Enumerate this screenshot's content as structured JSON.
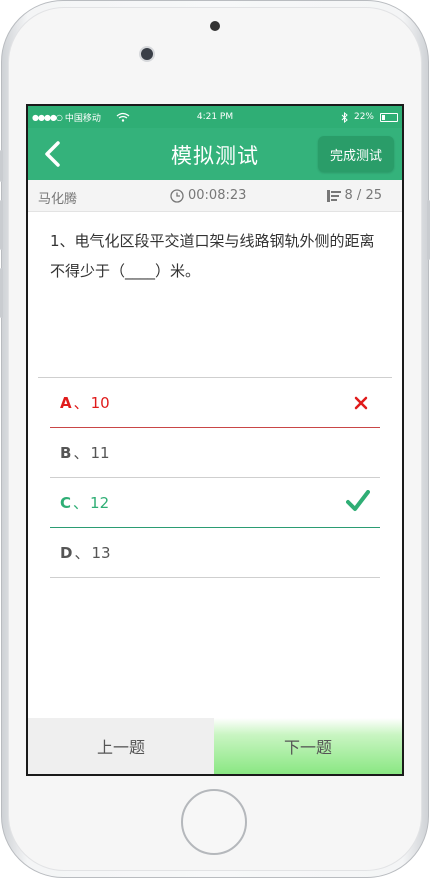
{
  "status_bar": {
    "carrier": "中国移动",
    "time": "4:21 PM",
    "battery": "22%"
  },
  "header": {
    "title": "模拟测试",
    "finish_label": "完成测试"
  },
  "info": {
    "name": "马化腾",
    "timer": "00:08:23",
    "progress": "8 / 25"
  },
  "question": {
    "text": "1、电气化区段平交道口架与线路钢轨外侧的距离不得少于（____）米。"
  },
  "options": [
    {
      "letter": "A",
      "sep": "、",
      "value": "10",
      "state": "wrong"
    },
    {
      "letter": "B",
      "sep": "、",
      "value": "11",
      "state": "normal"
    },
    {
      "letter": "C",
      "sep": "、",
      "value": "12",
      "state": "right"
    },
    {
      "letter": "D",
      "sep": "、",
      "value": "13",
      "state": "normal"
    }
  ],
  "nav": {
    "prev_label": "上一题",
    "next_label": "下一题"
  },
  "colors": {
    "primary": "#34b27b",
    "wrong": "#e01b1b",
    "right": "#2fae75"
  }
}
